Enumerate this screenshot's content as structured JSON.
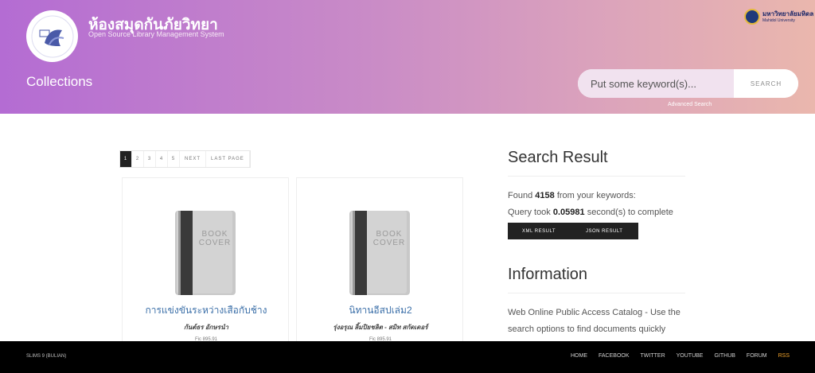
{
  "header": {
    "site_title": "ห้องสมุดกันภัยวิทยา",
    "site_subtitle": "Open Source Library Management System",
    "logo_text": "ห้องสมุด",
    "university_name": "มหาวิทยาลัยมหิดล",
    "university_sub": "Mahidol University",
    "section_title": "Collections",
    "search_placeholder": "Put some keyword(s)...",
    "search_button": "SEARCH",
    "advanced_search": "Advanced Search"
  },
  "pagination": {
    "pages": [
      "1",
      "2",
      "3",
      "4",
      "5"
    ],
    "active_page": "1",
    "next": "NEXT",
    "last": "LAST PAGE"
  },
  "books": [
    {
      "cover_line1": "BOOK",
      "cover_line2": "COVER",
      "title": "การแข่งขันระหว่างเสือกับช้าง",
      "author": "กันต์ธร อักษรนำ",
      "call_number": "Fic 895.91"
    },
    {
      "cover_line1": "BOOK",
      "cover_line2": "COVER",
      "title": "นิทานอีสปเล่ม2",
      "author": "รุ่งอรุณ ลิ้มปิยชลิต - สมิท สกัดเดอร์",
      "call_number": "Fic 895.91"
    }
  ],
  "sidebar": {
    "search_result_heading": "Search Result",
    "found_prefix": "Found",
    "found_count": "4158",
    "found_suffix": "from your keywords:",
    "query_prefix": "Query took",
    "query_time": "0.05981",
    "query_suffix": "second(s) to complete",
    "xml_result": "XML RESULT",
    "json_result": "JSON RESULT",
    "information_heading": "Information",
    "info_line1": "Web Online Public Access Catalog - Use the",
    "info_line2": "search options to find documents quickly"
  },
  "footer": {
    "version": "SLIMS 9 (BULIAN)",
    "nav": [
      "HOME",
      "FACEBOOK",
      "TWITTER",
      "YOUTUBE",
      "GITHUB",
      "FORUM",
      "RSS"
    ]
  },
  "colors": {
    "header_gradient_start": "#b46cd3",
    "header_gradient_end": "#eab7ad",
    "link_blue": "#3b6fa8",
    "rss_orange": "#f0a22b",
    "footer_bg": "#000000"
  }
}
